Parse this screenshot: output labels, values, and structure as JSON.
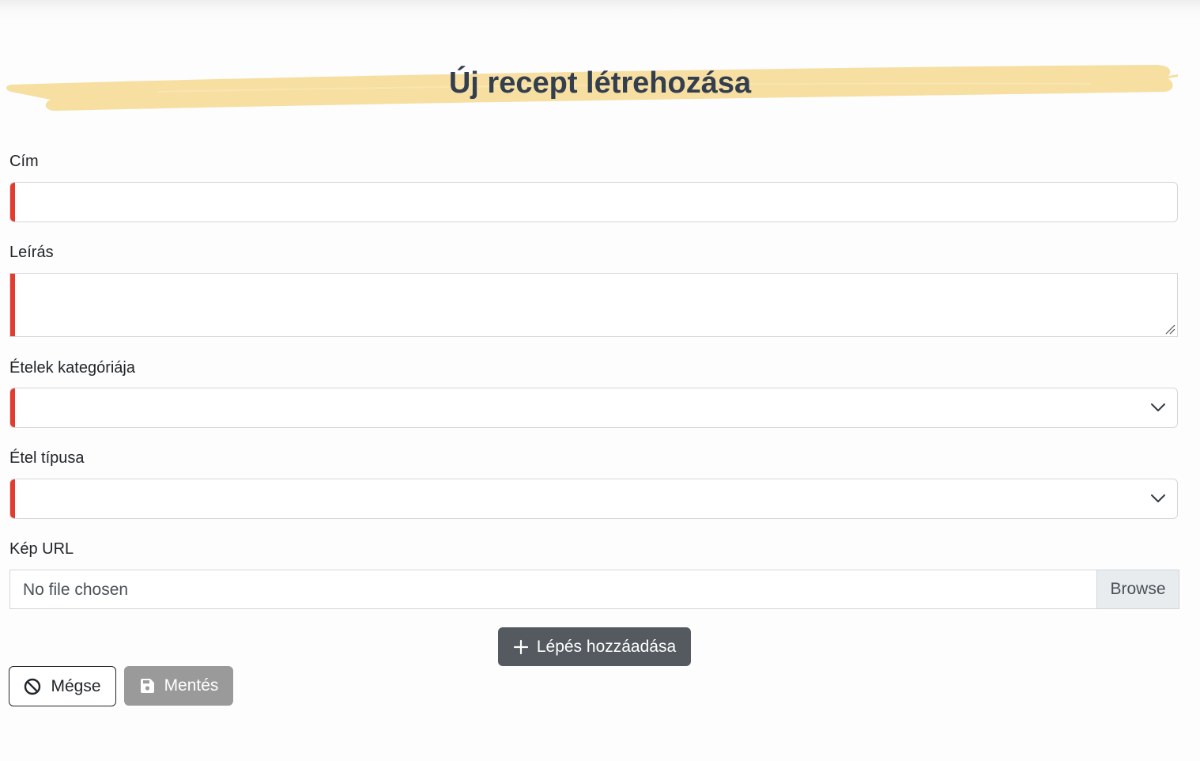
{
  "page": {
    "title": "Új recept létrehozása"
  },
  "form": {
    "title_label": "Cím",
    "title_value": "",
    "description_label": "Leírás",
    "description_value": "",
    "category_label": "Ételek kategóriája",
    "category_value": "",
    "type_label": "Étel típusa",
    "type_value": "",
    "image_label": "Kép URL",
    "file_status": "No file chosen",
    "browse_label": "Browse"
  },
  "actions": {
    "add_step_label": "Lépés hozzáadása",
    "cancel_label": "Mégse",
    "save_label": "Mentés"
  },
  "icons": {
    "add_step": "plus-icon",
    "cancel": "ban-icon",
    "save": "floppy-disk-icon",
    "select": "chevron-down-icon"
  },
  "colors": {
    "title_highlight": "#f7dfa2",
    "title_text": "#333e4e",
    "invalid_marker": "#e53a2e",
    "add_step_button": "#545a60",
    "save_button_disabled": "#9a9a9a"
  }
}
